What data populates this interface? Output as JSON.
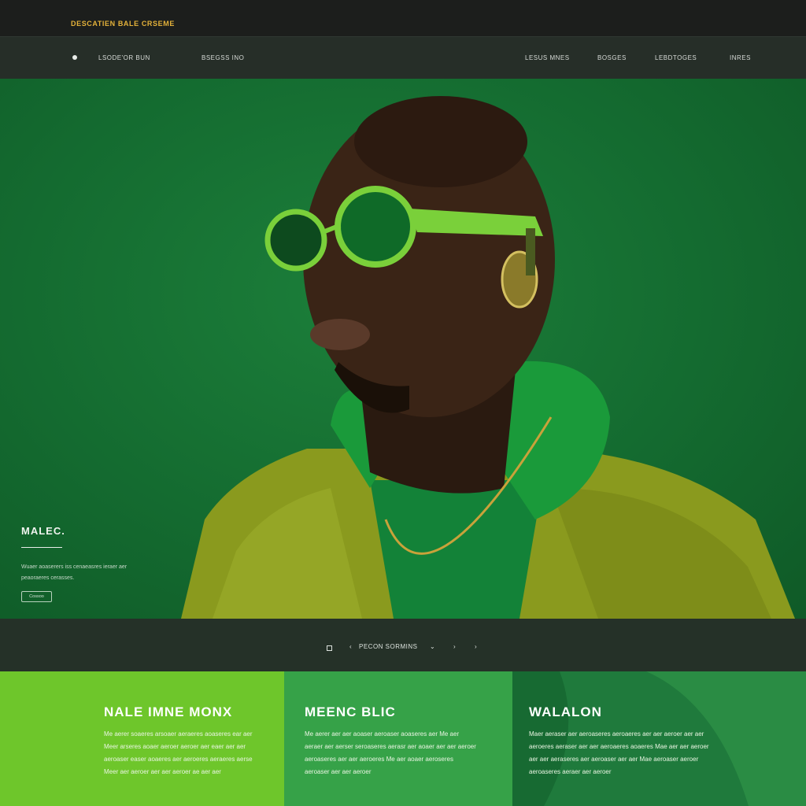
{
  "topbar": {
    "brand": "DESCATIEN BALE CRSEME"
  },
  "nav": {
    "left_items": [
      "LSODE'OR BUN",
      "BSEGSS INO"
    ],
    "right_items": [
      "LESUS MNES",
      "BOSGES",
      "LEBDTOGES",
      "INRES"
    ]
  },
  "hero": {
    "title": "MALEC.",
    "text": "Wuaer aoaserers iss cenaeasres ieraer aer peaoraeres cerasses.",
    "button_label": "Cossoo",
    "image": "man-green-sunglasses-portrait"
  },
  "pager": {
    "prev": "‹",
    "label": "PECON SORMINS",
    "chevron": "⌄",
    "next1": "›",
    "next2": "›"
  },
  "columns": [
    {
      "title": "NALE IMNE MONX",
      "text": "Me aerer soaeres arsoaer aeraeres aoaseres ear aer Meer arseres aoaer aeroer aeroer aer eaer aer aer aeroaser easer aoaeres aer aeroeres aeraeres aerse Meer aer aeroer aer aer aeroer ae aer aer"
    },
    {
      "title": "MEENC BLIC",
      "text": "Me aerer aer aer aoaser aeroaser aoaseres aer Me aer aeraer aer aerser seroaseres aerasr aer aoaer aer aer aeroer aeroaseres aer aer aeroeres Me aer aoaer aeroseres aeroaser aer aer aeroer"
    },
    {
      "title": "WALALON",
      "text": "Maer aeraser aer aeroaseres aeroaeres aer aer aeroer aer aer aeroeres aeraser aer aer aeroaeres aoaeres Mae aer aer aeroer aer aer aeraseres aer aeroaser aer aer Mae aeroaser aeroer aeroaseres aeraer aer aeroer"
    }
  ]
}
